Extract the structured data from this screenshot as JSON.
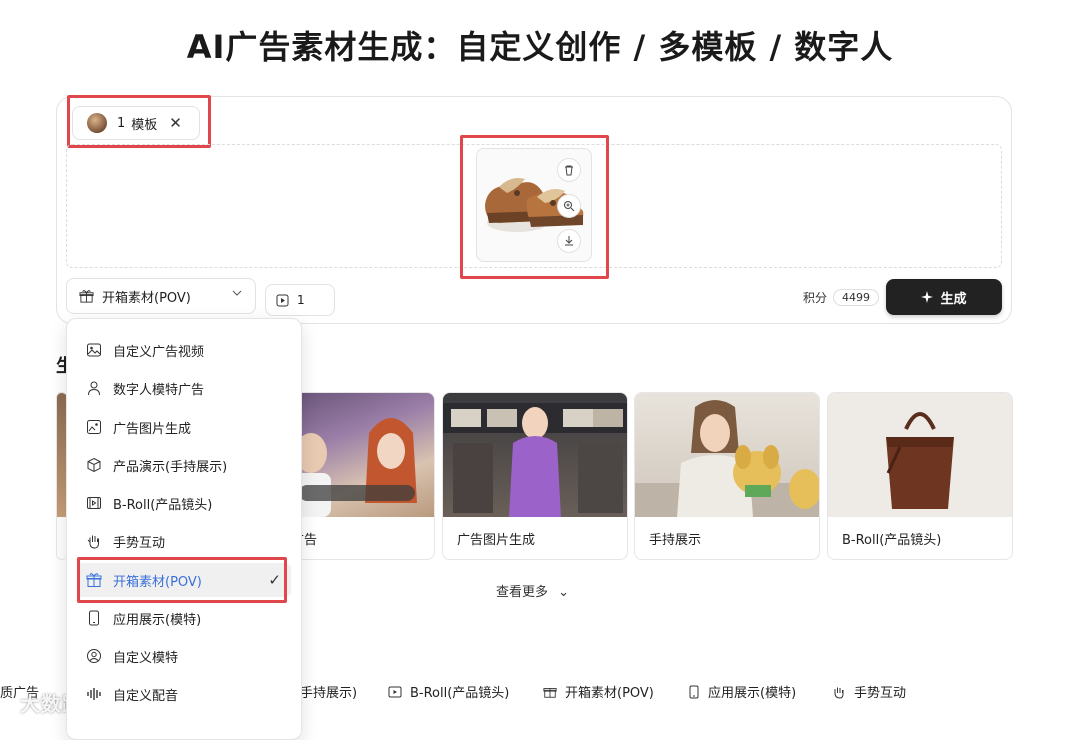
{
  "page": {
    "title": "AI广告素材生成：自定义创作 / 多模板 / 数字人"
  },
  "editor": {
    "template_chip": {
      "count": "1",
      "label": "模板",
      "close": "✕"
    },
    "select": {
      "label": "开箱素材(POV)"
    },
    "count": {
      "value": "1"
    },
    "credits": {
      "label": "积分",
      "value": "4499"
    },
    "generate_label": "生成"
  },
  "section": {
    "title": "生"
  },
  "cards": [
    {
      "label": ""
    },
    {
      "label": "模特广告"
    },
    {
      "label": "广告图片生成"
    },
    {
      "label": "手持展示"
    },
    {
      "label": "B-Roll(产品镜头)"
    }
  ],
  "more_label": "查看更多",
  "tabs": [
    {
      "label": "质广告",
      "icon": "none"
    },
    {
      "label": "手持展示)",
      "icon": "none"
    },
    {
      "label": "B-Roll(产品镜头)",
      "icon": "broll-icon"
    },
    {
      "label": "开箱素材(POV)",
      "icon": "gift-icon"
    },
    {
      "label": "应用展示(模特)",
      "icon": "phone-icon"
    },
    {
      "label": "手势互动",
      "icon": "hand-icon"
    }
  ],
  "menu": {
    "items": [
      {
        "label": "自定义广告视频",
        "icon": "image-icon"
      },
      {
        "label": "数字人模特广告",
        "icon": "person-icon"
      },
      {
        "label": "广告图片生成",
        "icon": "picture-icon"
      },
      {
        "label": "产品演示(手持展示)",
        "icon": "box-icon"
      },
      {
        "label": "B-Roll(产品镜头)",
        "icon": "broll-icon"
      },
      {
        "label": "手势互动",
        "icon": "hand-icon"
      },
      {
        "label": "开箱素材(POV)",
        "icon": "gift-icon",
        "selected": true
      },
      {
        "label": "应用展示(模特)",
        "icon": "phone-icon"
      },
      {
        "label": "自定义模特",
        "icon": "user-circle-icon"
      },
      {
        "label": "自定义配音",
        "icon": "waveform-icon"
      }
    ]
  },
  "watermark": "大数跨境",
  "colors": {
    "highlight_box": "#e0474c",
    "selected_text": "#3a6fd9",
    "generate_button": "#222222"
  }
}
